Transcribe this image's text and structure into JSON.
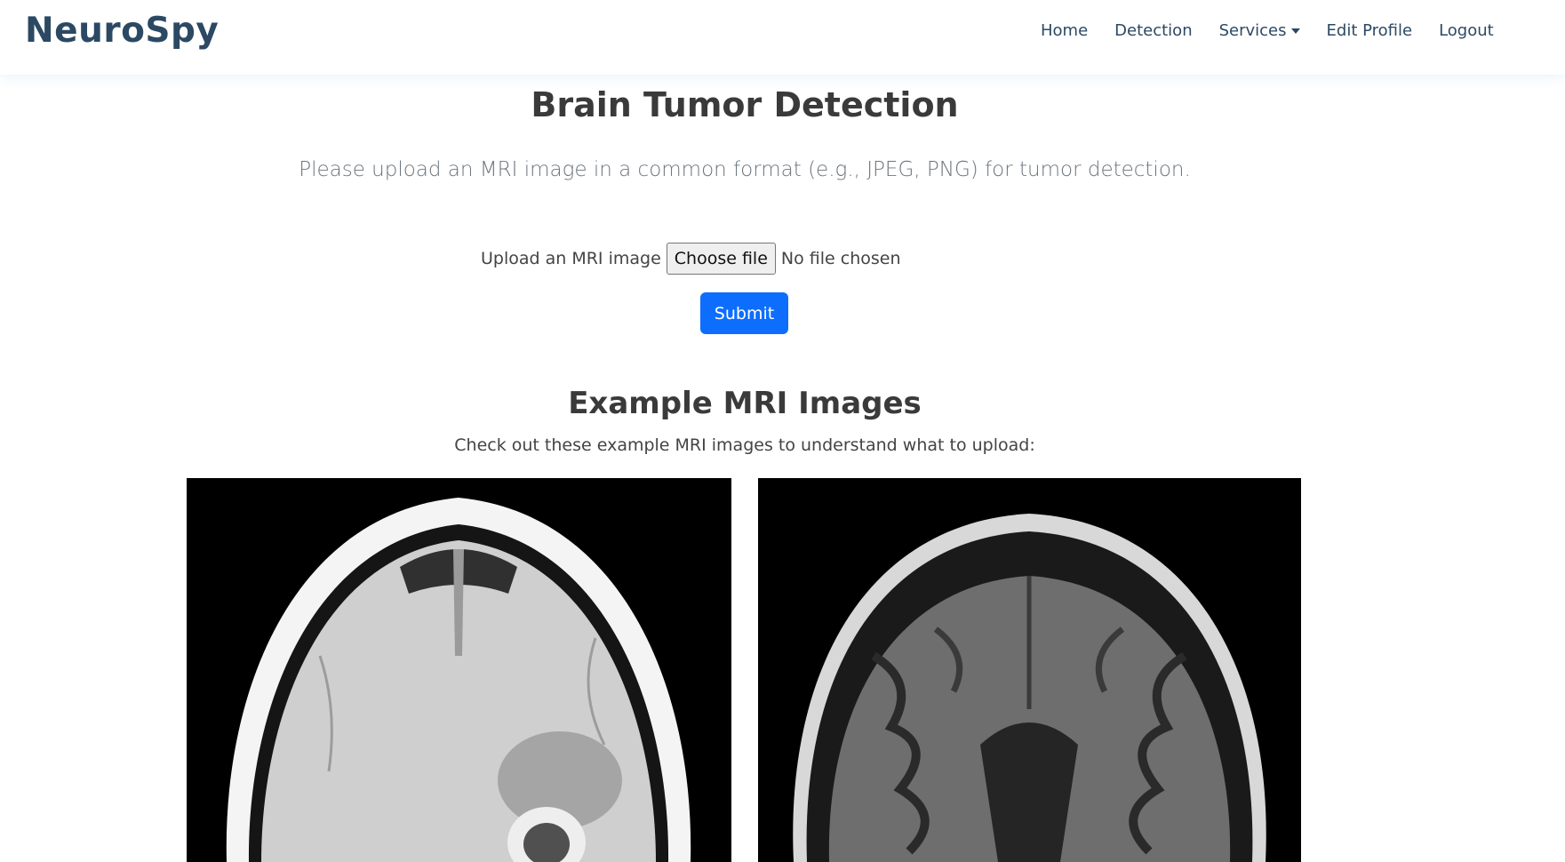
{
  "navbar": {
    "brand": "NeuroSpy",
    "links": [
      "Home",
      "Detection",
      "Services",
      "Edit Profile",
      "Logout"
    ]
  },
  "main": {
    "title": "Brain Tumor Detection",
    "lead": "Please upload an MRI image in a common format (e.g., JPEG, PNG) for tumor detection.",
    "upload": {
      "label": "Upload an MRI image",
      "button": "Choose file",
      "status": "No file chosen"
    },
    "submit": "Submit"
  },
  "examples": {
    "title": "Example MRI Images",
    "subtitle": "Check out these example MRI images to understand what to upload:"
  },
  "icons": {
    "services_dropdown": "caret-down-icon"
  },
  "colors": {
    "brand": "#2c4964",
    "primary": "#0d6efd"
  }
}
